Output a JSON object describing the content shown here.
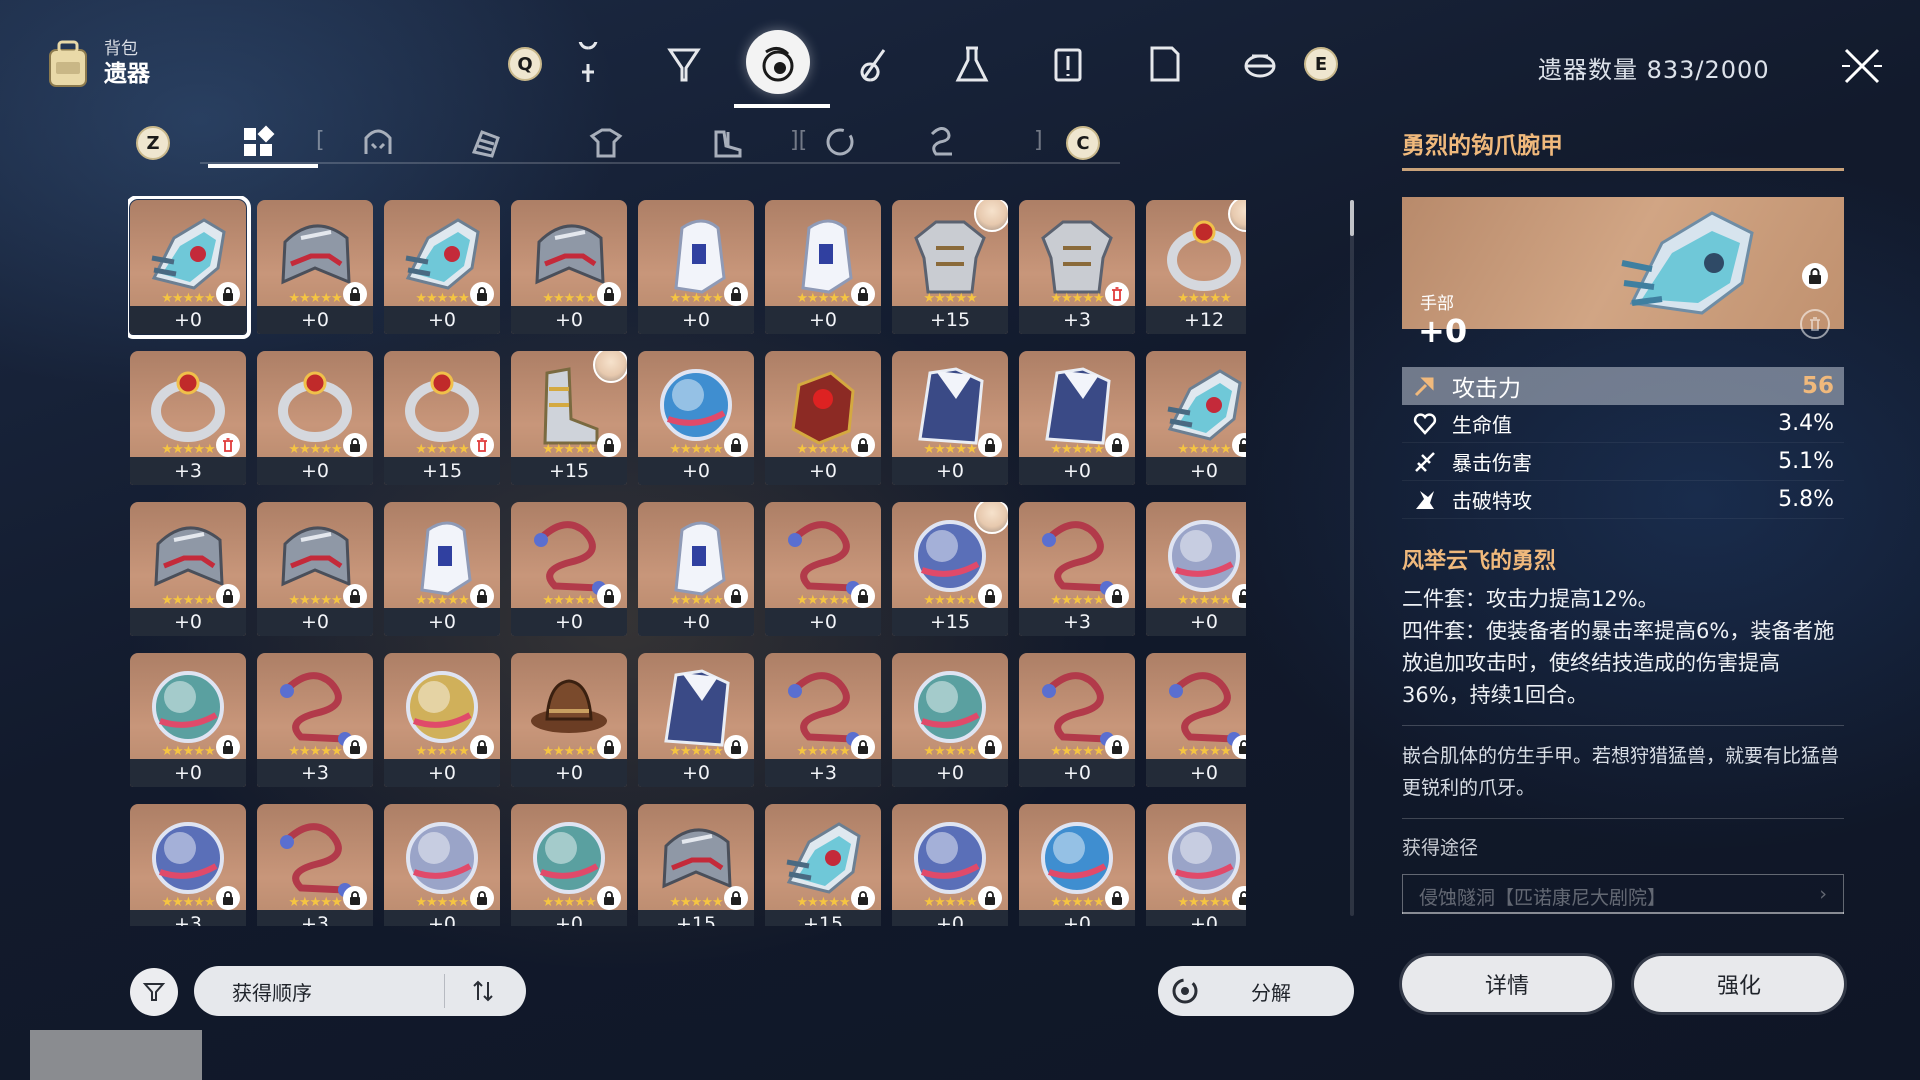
{
  "header": {
    "section_small": "背包",
    "section_big": "遗器",
    "left_key": "Q",
    "right_key": "E",
    "count_label": "遗器数量 833/2000",
    "categories": [
      "lightcone-icon",
      "material-icon",
      "relic-icon",
      "consumable-icon",
      "flask-icon",
      "mission-icon",
      "document-icon",
      "robot-icon"
    ],
    "active_category": 2
  },
  "subtabs": {
    "left_key": "Z",
    "right_key": "C",
    "items": [
      "all-icon",
      "head-icon",
      "hand-icon",
      "body-icon",
      "feet-icon",
      "sphere-icon",
      "rope-icon"
    ],
    "active": 0
  },
  "colors": {
    "accent_gold": "#f0b97c",
    "card_bg": "#c8967a",
    "star": "#f5c542"
  },
  "grid": {
    "stars": "★★★★★",
    "items": [
      {
        "type": "hand",
        "lvl": "+0",
        "tag": "lock",
        "selected": true
      },
      {
        "type": "head",
        "lvl": "+0",
        "tag": "lock"
      },
      {
        "type": "hand",
        "lvl": "+0",
        "tag": "lock"
      },
      {
        "type": "head",
        "lvl": "+0",
        "tag": "lock"
      },
      {
        "type": "glove",
        "lvl": "+0",
        "tag": "lock"
      },
      {
        "type": "glove",
        "lvl": "+0",
        "tag": "lock"
      },
      {
        "type": "armor",
        "lvl": "+15",
        "tag": "none",
        "char": true
      },
      {
        "type": "armor",
        "lvl": "+3",
        "tag": "trash"
      },
      {
        "type": "ring",
        "lvl": "+12",
        "tag": "none",
        "char": true
      },
      {
        "type": "ring",
        "lvl": "+3",
        "tag": "trash"
      },
      {
        "type": "ring",
        "lvl": "+0",
        "tag": "lock"
      },
      {
        "type": "ring",
        "lvl": "+15",
        "tag": "trash"
      },
      {
        "type": "boots",
        "lvl": "+15",
        "tag": "lock",
        "char": true
      },
      {
        "type": "sphere",
        "lvl": "+0",
        "tag": "lock"
      },
      {
        "type": "gauntlet",
        "lvl": "+0",
        "tag": "lock"
      },
      {
        "type": "coat",
        "lvl": "+0",
        "tag": "lock"
      },
      {
        "type": "coat",
        "lvl": "+0",
        "tag": "lock"
      },
      {
        "type": "hand",
        "lvl": "+0",
        "tag": "lock"
      },
      {
        "type": "head",
        "lvl": "+0",
        "tag": "lock"
      },
      {
        "type": "head",
        "lvl": "+0",
        "tag": "lock"
      },
      {
        "type": "glove",
        "lvl": "+0",
        "tag": "lock"
      },
      {
        "type": "rope",
        "lvl": "+0",
        "tag": "lock"
      },
      {
        "type": "glove",
        "lvl": "+0",
        "tag": "lock"
      },
      {
        "type": "rope",
        "lvl": "+0",
        "tag": "lock"
      },
      {
        "type": "sphere",
        "lvl": "+15",
        "tag": "lock",
        "char": true
      },
      {
        "type": "rope",
        "lvl": "+3",
        "tag": "lock"
      },
      {
        "type": "sphere",
        "lvl": "+0",
        "tag": "lock"
      },
      {
        "type": "sphere",
        "lvl": "+0",
        "tag": "lock"
      },
      {
        "type": "rope",
        "lvl": "+3",
        "tag": "lock"
      },
      {
        "type": "sphere",
        "lvl": "+0",
        "tag": "lock"
      },
      {
        "type": "hat",
        "lvl": "+0",
        "tag": "lock"
      },
      {
        "type": "coat",
        "lvl": "+0",
        "tag": "lock"
      },
      {
        "type": "rope",
        "lvl": "+3",
        "tag": "lock"
      },
      {
        "type": "sphere",
        "lvl": "+0",
        "tag": "lock"
      },
      {
        "type": "rope",
        "lvl": "+0",
        "tag": "lock"
      },
      {
        "type": "rope",
        "lvl": "+0",
        "tag": "lock"
      },
      {
        "type": "sphere",
        "lvl": "+3",
        "tag": "lock"
      },
      {
        "type": "rope",
        "lvl": "+3",
        "tag": "lock"
      },
      {
        "type": "sphere",
        "lvl": "+0",
        "tag": "lock"
      },
      {
        "type": "sphere",
        "lvl": "+0",
        "tag": "lock"
      },
      {
        "type": "head",
        "lvl": "+15",
        "tag": "lock"
      },
      {
        "type": "hand",
        "lvl": "+15",
        "tag": "lock"
      },
      {
        "type": "sphere",
        "lvl": "+0",
        "tag": "lock"
      },
      {
        "type": "sphere",
        "lvl": "+0",
        "tag": "lock"
      },
      {
        "type": "sphere",
        "lvl": "+0",
        "tag": "lock"
      }
    ]
  },
  "bottom": {
    "sort_label": "获得顺序",
    "salvage_label": "分解"
  },
  "detail": {
    "title": "勇烈的钩爪腕甲",
    "slot": "手部",
    "level": "+0",
    "main_stat": {
      "name": "攻击力",
      "value": "56"
    },
    "sub_stats": [
      {
        "icon": "heart-icon",
        "name": "生命值",
        "value": "3.4%"
      },
      {
        "icon": "crit-dmg-icon",
        "name": "暴击伤害",
        "value": "5.1%"
      },
      {
        "icon": "break-icon",
        "name": "击破特攻",
        "value": "5.8%"
      }
    ],
    "set_name": "风举云飞的勇烈",
    "set_2pc": "二件套：攻击力提高12%。",
    "set_4pc": "四件套：使装备者的暴击率提高6%，装备者施放追加攻击时，使终结技造成的伤害提高36%，持续1回合。",
    "lore": "嵌合肌体的仿生手甲。若想狩猎猛兽，就要有比猛兽更锐利的爪牙。",
    "source_label": "获得途径",
    "source_value": "侵蚀隧洞【匹诺康尼大剧院】",
    "details_btn": "详情",
    "enhance_btn": "强化"
  }
}
